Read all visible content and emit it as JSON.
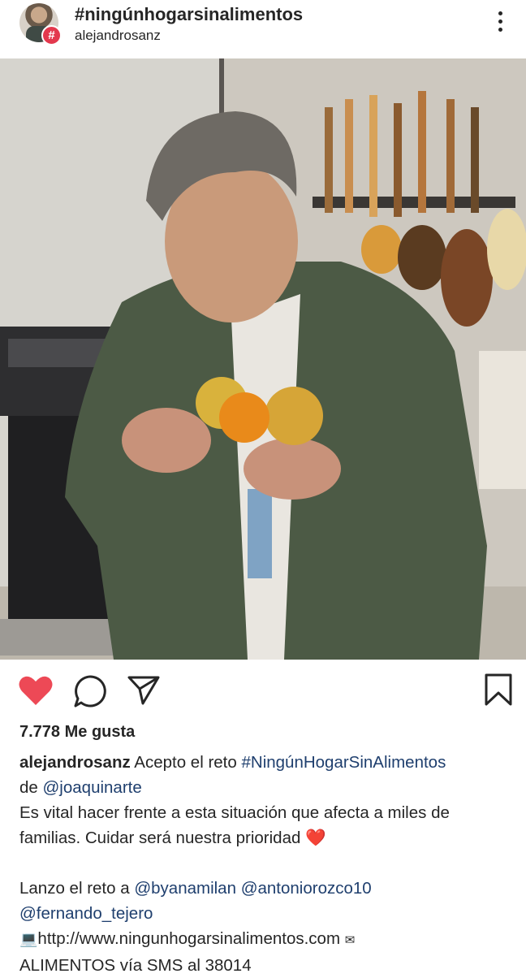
{
  "header": {
    "title": "#ningúnhogarsinalimentos",
    "subtitle": "alejandrosanz",
    "badge": "#"
  },
  "actions": {
    "like_icon": "heart-filled-icon",
    "comment_icon": "comment-icon",
    "share_icon": "send-icon",
    "save_icon": "bookmark-icon",
    "like_color": "#ed4956"
  },
  "post": {
    "likes": "7.778 Me gusta",
    "author": "alejandrosanz",
    "caption": {
      "l1_text": " Acepto el reto ",
      "l1_tag": "#NingúnHogarSinAlimentos",
      "l2_pre": "de ",
      "l2_mention": "@joaquinarte",
      "l3": "Es vital hacer frente a esta situación que afecta a miles de",
      "l4_text": "familias. Cuidar será nuestra prioridad ",
      "l4_emoji": "❤️",
      "l5_pre": "Lanzo el reto a ",
      "l5_m1": "@byanamilan",
      "l5_m2": "@antoniorozco10",
      "l6_m3": "@fernando_tejero",
      "l7_emoji": "💻",
      "l7_url": "http://www.ningunhogarsinalimentos.com",
      "l7_emoji2": "✉",
      "l8": "ALIMENTOS vía SMS al 38014"
    }
  }
}
